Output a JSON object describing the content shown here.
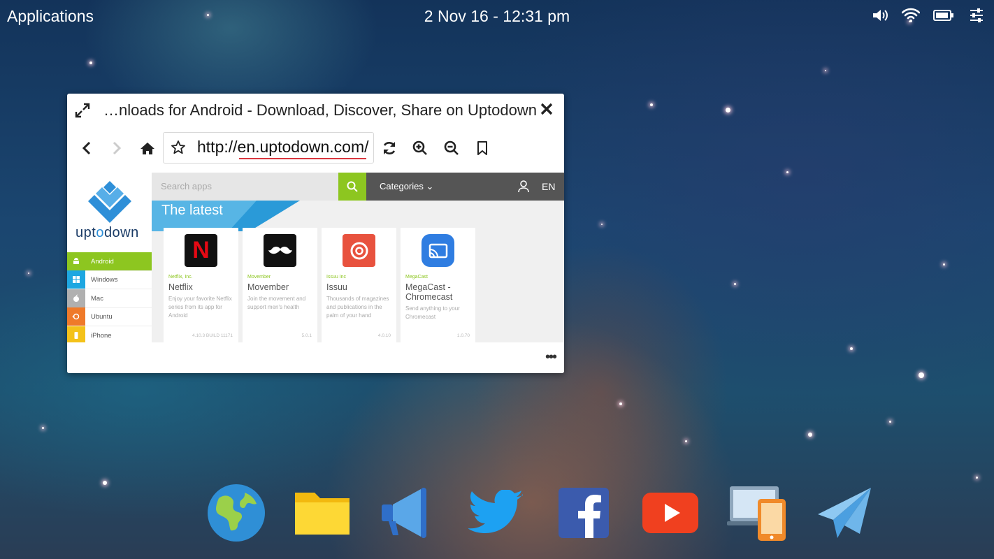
{
  "topbar": {
    "applications_label": "Applications",
    "clock": "2 Nov 16 - 12:31 pm",
    "tray_icons": [
      "volume-icon",
      "wifi-icon",
      "battery-icon",
      "settings-sliders-icon"
    ]
  },
  "window": {
    "title": "…nloads for Android - Download, Discover, Share on Uptodown",
    "url": "http://en.uptodown.com/",
    "toolbar_icons": [
      "back-icon",
      "forward-icon",
      "home-icon",
      "bookmark-star-icon",
      "refresh-icon",
      "zoom-in-icon",
      "zoom-out-icon",
      "bookmark-icon"
    ],
    "more_label": "•••"
  },
  "site": {
    "logo_text_pre": "upt",
    "logo_text_o": "o",
    "logo_text_post": "down",
    "search_placeholder": "Search apps",
    "categories_label": "Categories",
    "lang": "EN",
    "banner_title": "The latest",
    "accent_color": "#8dc620",
    "platforms": [
      {
        "label": "Android",
        "color": "#8dc620"
      },
      {
        "label": "Windows",
        "color": "#1ea7e1"
      },
      {
        "label": "Mac",
        "color": "#b0b0b0"
      },
      {
        "label": "Ubuntu",
        "color": "#ef7a2a"
      },
      {
        "label": "iPhone",
        "color": "#f4c21a"
      }
    ],
    "apps": [
      {
        "developer": "Netflix, Inc.",
        "name": "Netflix",
        "description": "Enjoy your favorite Netflix series from its app for Android",
        "version": "4.10.3 BUILD 11171",
        "icon_color": "#111111"
      },
      {
        "developer": "Movember",
        "name": "Movember",
        "description": "Join the movement and support men's health",
        "version": "5.0.1",
        "icon_color": "#111111"
      },
      {
        "developer": "Issuu Inc",
        "name": "Issuu",
        "description": "Thousands of magazines and publications in the palm of your hand",
        "version": "4.0.10",
        "icon_color": "#e8523e"
      },
      {
        "developer": "MegaCast",
        "name": "MegaCast - Chromecast",
        "description": "Send anything to your Chromecast",
        "version": "1.0.70",
        "icon_color": "#2f7de1"
      }
    ]
  },
  "dock": [
    "globe-icon",
    "folder-icon",
    "megaphone-icon",
    "twitter-icon",
    "facebook-icon",
    "youtube-icon",
    "devices-icon",
    "paper-plane-icon"
  ]
}
